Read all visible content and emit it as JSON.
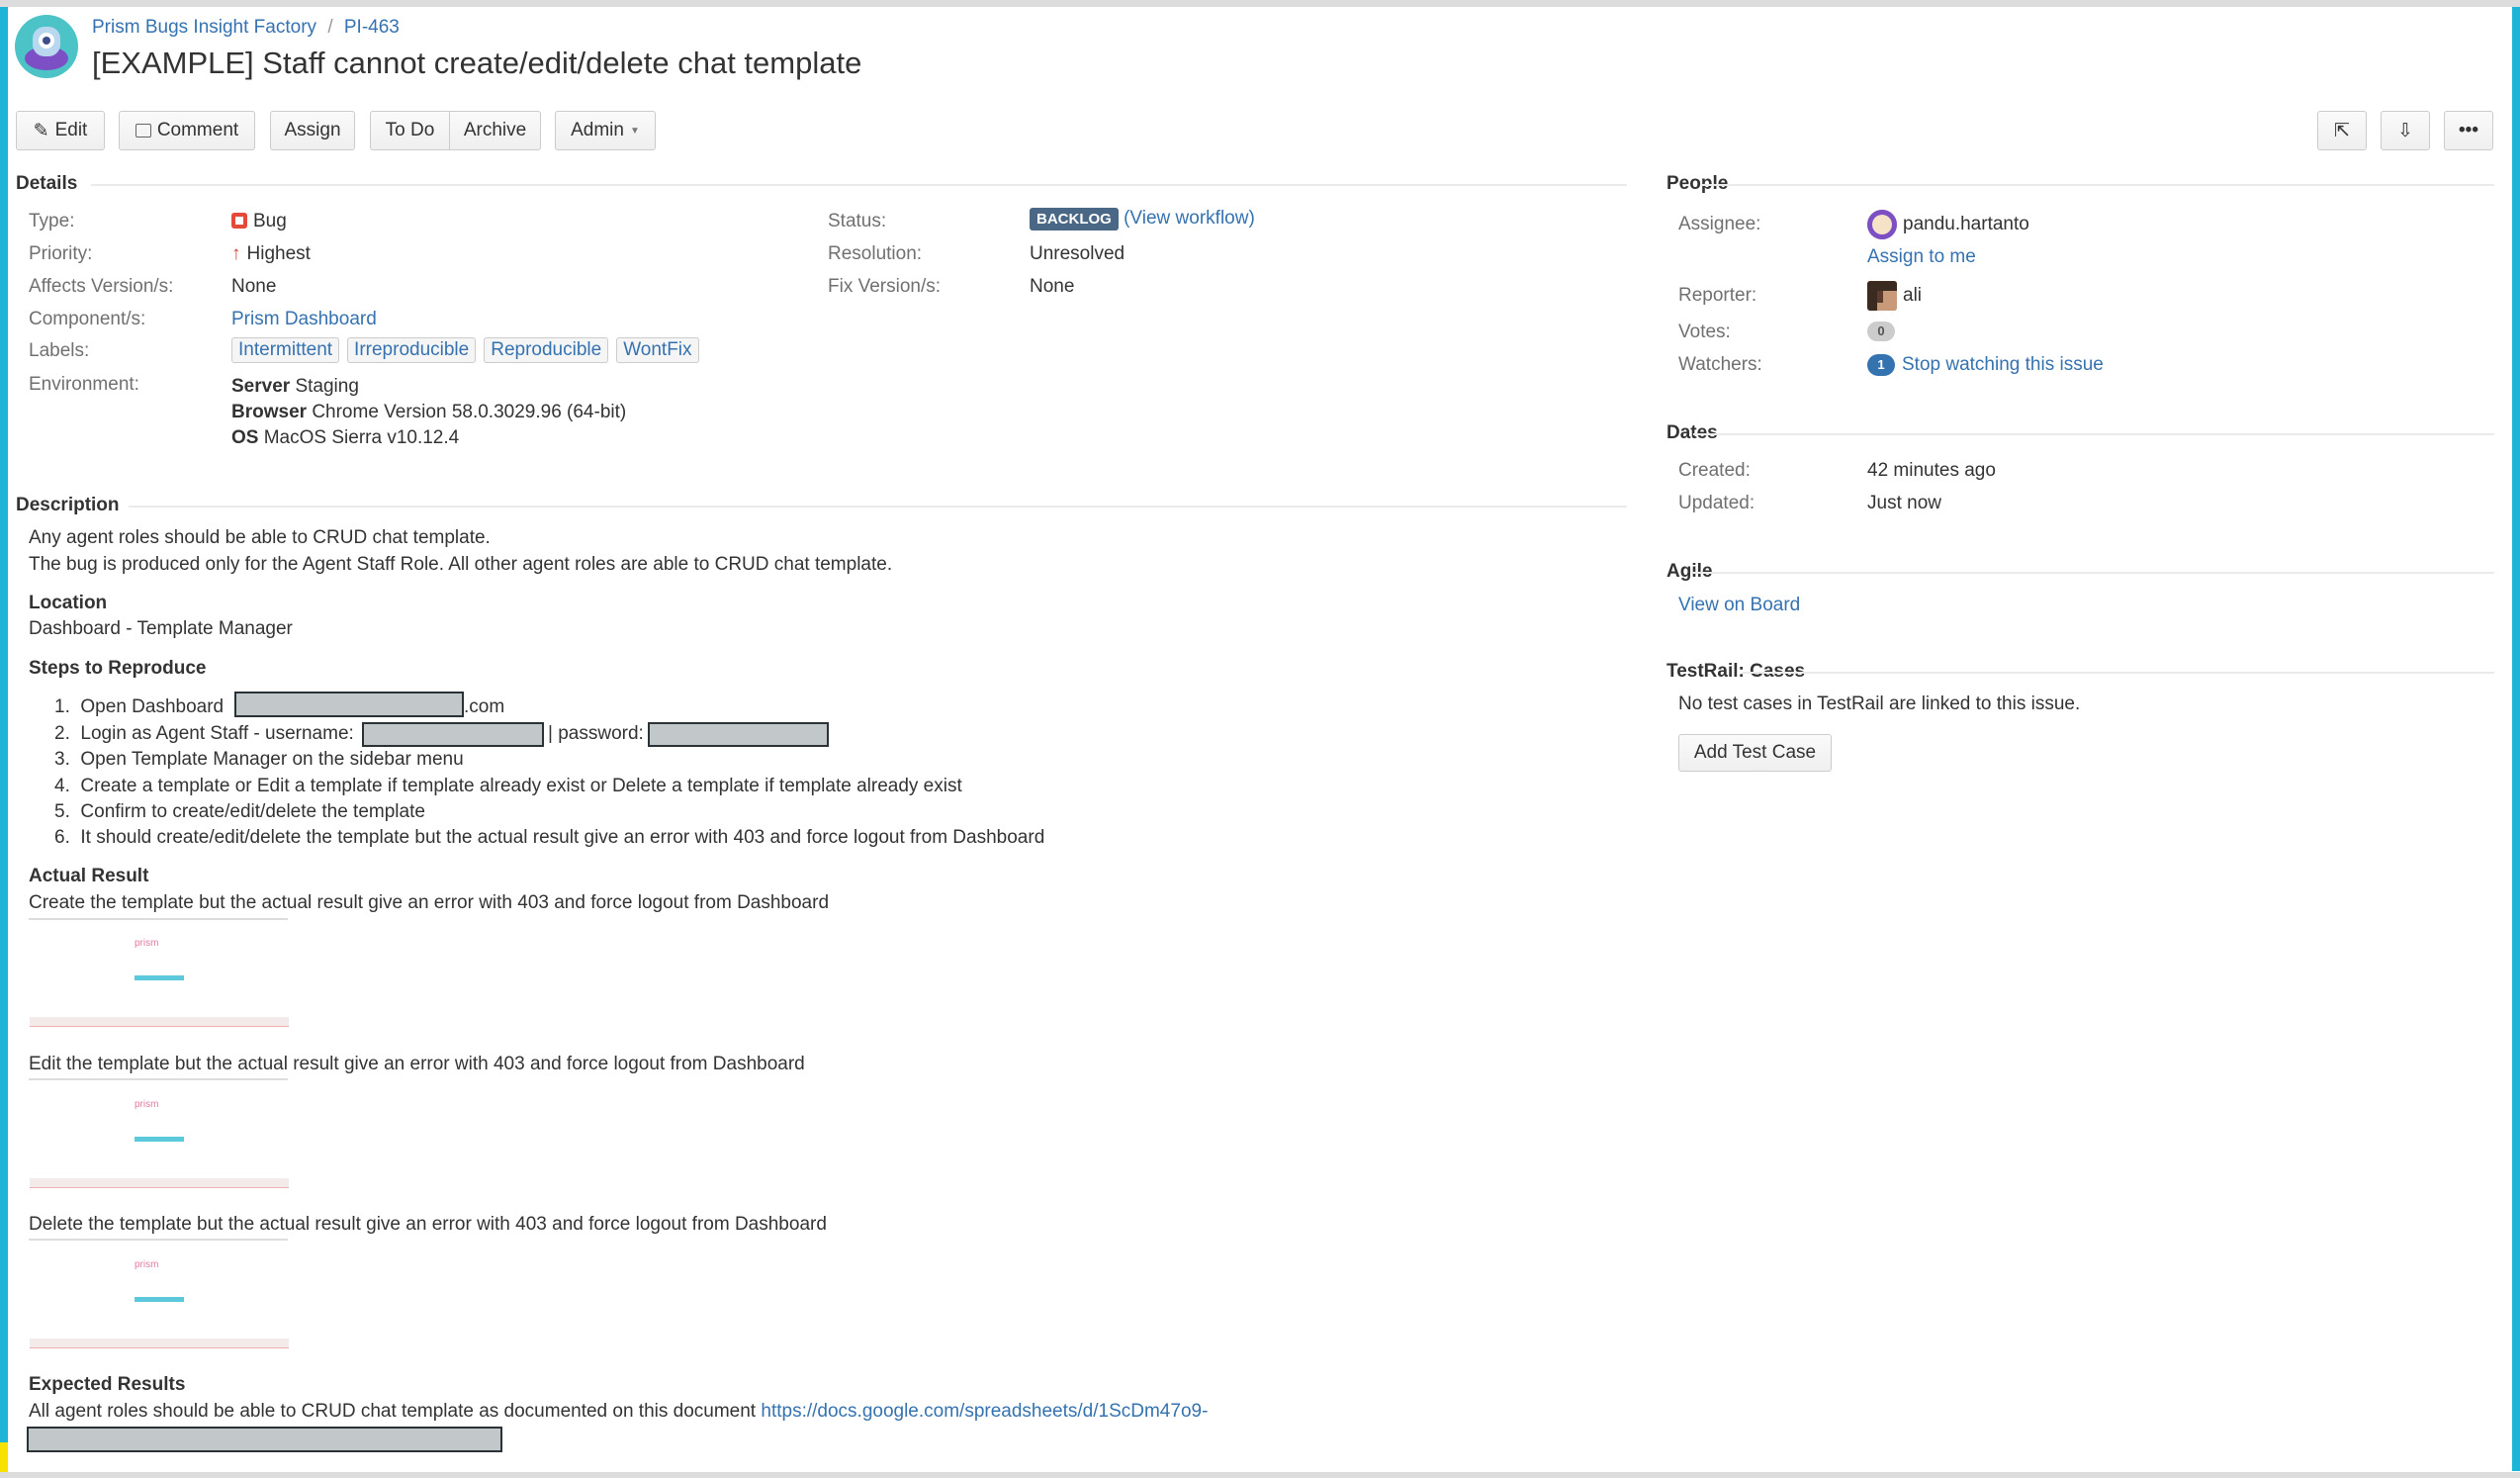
{
  "header": {
    "project": "Prism Bugs Insight Factory",
    "separator": "/",
    "issue_key": "PI-463",
    "title": "[EXAMPLE] Staff cannot create/edit/delete chat template"
  },
  "toolbar": {
    "edit": "Edit",
    "comment": "Comment",
    "assign": "Assign",
    "todo": "To Do",
    "archive": "Archive",
    "admin": "Admin",
    "icons": [
      "share-icon",
      "export-icon",
      "more-icon"
    ]
  },
  "details": {
    "heading": "Details",
    "type_label": "Type:",
    "type": "Bug",
    "priority_label": "Priority:",
    "priority": "Highest",
    "affects_label": "Affects Version/s:",
    "affects": "None",
    "component_label": "Component/s:",
    "component": "Prism Dashboard",
    "labels_label": "Labels:",
    "labels": [
      "Intermittent",
      "Irreproducible",
      "Reproducible",
      "WontFix"
    ],
    "environment_label": "Environment:",
    "env": [
      {
        "k": "Server",
        "v": "Staging"
      },
      {
        "k": "Browser",
        "v": "Chrome Version 58.0.3029.96 (64-bit)"
      },
      {
        "k": "OS",
        "v": "MacOS Sierra v10.12.4"
      }
    ],
    "status_label": "Status:",
    "status": "BACKLOG",
    "view_workflow": "(View workflow)",
    "resolution_label": "Resolution:",
    "resolution": "Unresolved",
    "fix_label": "Fix Version/s:",
    "fix": "None"
  },
  "description": {
    "heading": "Description",
    "intro": [
      "Any agent roles should be able to CRUD chat template.",
      "The bug is produced only for the Agent Staff Role. All other agent roles are able to CRUD chat template."
    ],
    "location_heading": "Location",
    "location": "Dashboard - Template Manager",
    "steps_heading": "Steps to Reproduce",
    "steps": [
      "Open Dashboard",
      ".com",
      "Login as Agent Staff - username:",
      "| password:",
      "Open Template Manager on the sidebar menu",
      "Create a template or Edit a template if template already exist or Delete a template if template already exist",
      "Confirm to create/edit/delete the template",
      "It should create/edit/delete the template but the actual result give an error with 403 and force logout from Dashboard"
    ],
    "actual_heading": "Actual Result",
    "actual": [
      "Create the template but the actual result give an error with 403 and force logout from Dashboard",
      "Edit the template but the actual result give an error with 403 and force logout from Dashboard",
      "Delete the template but the actual result give an error with 403 and force logout from Dashboard"
    ],
    "thumb_logo": "prism",
    "expected_heading": "Expected Results",
    "expected": "All agent roles should be able to CRUD chat template as documented on this document",
    "expected_link": "https://docs.google.com/spreadsheets/d/1ScDm47o9-"
  },
  "people": {
    "heading": "People",
    "assignee_label": "Assignee:",
    "assignee": "pandu.hartanto",
    "assign_to_me": "Assign to me",
    "reporter_label": "Reporter:",
    "reporter": "ali",
    "votes_label": "Votes:",
    "votes": "0",
    "watchers_label": "Watchers:",
    "watchers": "1",
    "stop_watching": "Stop watching this issue"
  },
  "dates": {
    "heading": "Dates",
    "created_label": "Created:",
    "created": "42 minutes ago",
    "updated_label": "Updated:",
    "updated": "Just now"
  },
  "agile": {
    "heading": "Agile",
    "view_on_board": "View on Board"
  },
  "testrail": {
    "heading": "TestRail: Cases",
    "none": "No test cases in TestRail are linked to this issue.",
    "add": "Add Test Case"
  },
  "colors": {
    "link": "#3572b0",
    "status": "#4a6785",
    "accent": "#1eb4d8"
  }
}
